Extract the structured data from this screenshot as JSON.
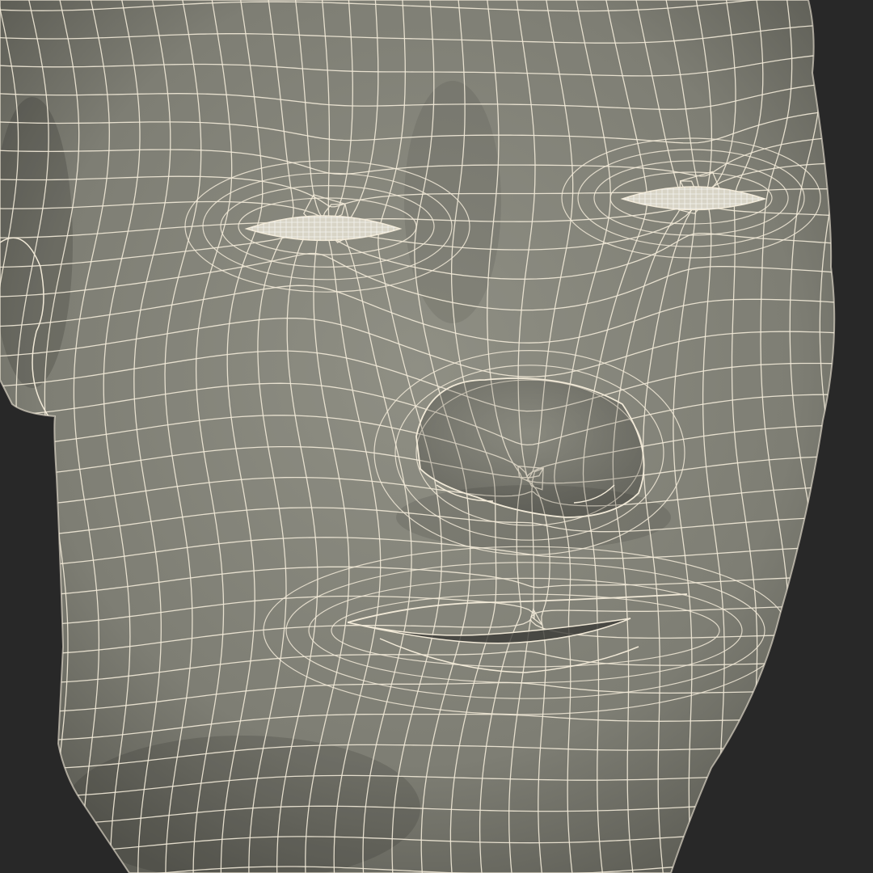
{
  "scene": {
    "subject": "wireframe-face",
    "colors": {
      "background": "#282828",
      "surface": "#7e7e74",
      "surface_light": "#8f8f84",
      "surface_shadow": "#5e5e56",
      "wire": "#f2ead8",
      "eye": "#d8d4c6",
      "mouth": "#3a3a36"
    }
  }
}
